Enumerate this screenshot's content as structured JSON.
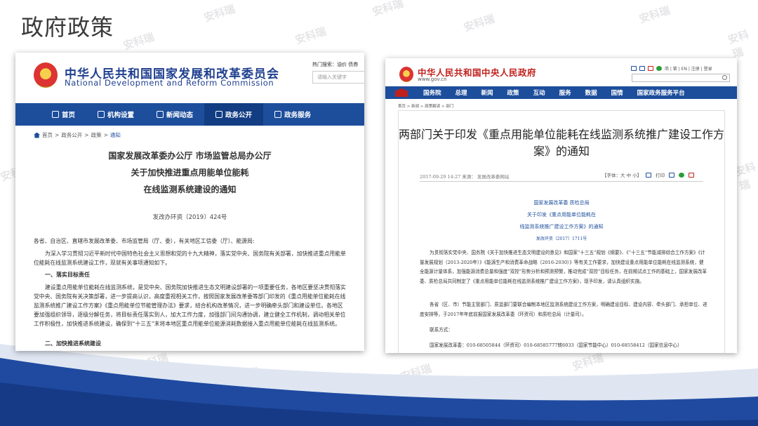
{
  "slide": {
    "title": "政府政策",
    "watermark": "安科瑞",
    "accent_color": "#1d4e9c"
  },
  "ndrc": {
    "name_cn": "中华人民共和国国家发展和改革委员会",
    "name_en": "National Development and Reform Commission",
    "hot_search": "热门搜索：油价  债券",
    "search_placeholder": "请输入关键字",
    "nav": [
      {
        "label": "首页",
        "icon": "home-icon"
      },
      {
        "label": "机构设置",
        "icon": "building-icon"
      },
      {
        "label": "新闻动态",
        "icon": "news-icon"
      },
      {
        "label": "政务公开",
        "icon": "open-icon"
      },
      {
        "label": "政务服务",
        "icon": "service-icon"
      }
    ],
    "breadcrumb": [
      "首页",
      ">",
      "政务公开",
      ">",
      "政策",
      ">",
      "通知"
    ],
    "title_lines": [
      "国家发展改革委办公厅 市场监管总局办公厅",
      "关于加快推进重点用能单位能耗",
      "在线监测系统建设的通知"
    ],
    "doc_number": "发改办环资〔2019〕424号",
    "addressee": "各省、自治区、直辖市发展改革委、市场监管局（厅、委），有关地区工信委（厅）、能源局:",
    "intro": "为深入学习贯彻习近平新时代中国特色社会主义思想和党的十九大精神，落实党中央、国务院有关部署，加快推进重点用能单位能耗在线监测系统建设工作，现就有关事项通知如下。",
    "section1_title": "一、落实目标责任",
    "section1_text": "建设重点用能单位能耗在线监测系统，是党中央、国务院加快推进生态文明建设部署的一项重要任务，各地区要坚决贯彻落实党中央、国务院有关决策部署，进一步提高认识，高度重视相关工作，按照国家发展改革委等部门印发的《重点用能单位能耗在线监测系统推广建设工作方案》《重点用能单位节能管理办法》要求，结合机构改革情况，进一步明确牵头部门和建设单位。各地区要加强组织领导，逐级分解任务，将目标责任落实到人，加大工作力度，加强部门间沟通协调，建立健全工作机制，调动相关单位工作积极性，加快推进系统建设，确保到“十三五”末将本地区重点用能单位能源消耗数据接入重点用能单位能耗在线监测系统。",
    "section2_title": "二、加快推进系统建设"
  },
  "gov": {
    "name_cn": "中华人民共和国中央人民政府",
    "url": "www.gov.cn",
    "top_links": "简 | 繁 | EN | 注册 | 登录",
    "nav": [
      "国务院",
      "总理",
      "新闻",
      "政策",
      "互动",
      "服务",
      "数据",
      "国情",
      "国家政务服务平台"
    ],
    "breadcrumb": "首页  >  新闻  >  政策解读  >  部门",
    "title": "两部门关于印发《重点用能单位能耗在线监测系统推广建设工作方案》的通知",
    "date_source": "2017-09-29 14:27   来源：  发展改革委网站",
    "font_size_tool": "【字体：大 中 小】",
    "print_label": "打印",
    "issuer": "国家发展改革委  质检总局",
    "doc_title_lines": [
      "关于印发《重点用能单位能耗在",
      "线监测系统推广建设工作方案》的通知"
    ],
    "doc_number": "发改环资〔2017〕1711号",
    "para1": "为贯彻落实党中央、国务院《关于加快推进生态文明建设的意见》和国家“十三五”规划《纲要》、《“十三五”节能减排综合工作方案》《计量发展规划（2013-2020年）》《能源生产和消费革命战略（2016-2030）》等有关工作要求，加快建设重点用能单位能耗在线监测系统，健全能源计量体系，加强能源消费总量和强度“双控”形势分析和预测预警，推动完成“双控”目标任务，在前期试点工作的基础上，国家发展改革委、质检总局共同制定了《重点用能单位能耗在线监测系统推广建设工作方案》，现予印发，请认真组织实施。",
    "para2": "各省（区、市）节能主管部门、质监部门要联合编制本地区监测系统建设工作方案，明确建设目标、建设内容、牵头部门、承担单位、进度安排等，于2017年年底前报国家发展改革委（环资司）和质检总局（计量司）。",
    "contact_label": "联系方式：",
    "contact": "国家发展改革委：010-68505844（环资司）010-68585777转6033（国家节能中心）010-68558412（国家信息中心）"
  }
}
